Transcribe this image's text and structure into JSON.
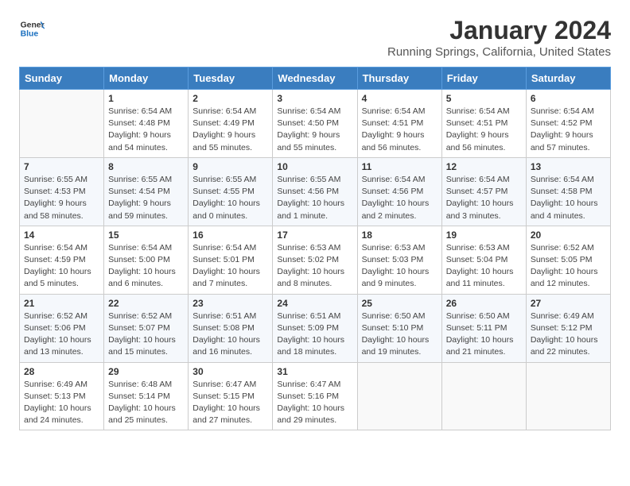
{
  "header": {
    "logo_general": "General",
    "logo_blue": "Blue",
    "month_year": "January 2024",
    "location": "Running Springs, California, United States"
  },
  "days_of_week": [
    "Sunday",
    "Monday",
    "Tuesday",
    "Wednesday",
    "Thursday",
    "Friday",
    "Saturday"
  ],
  "weeks": [
    [
      {
        "day": "",
        "info": ""
      },
      {
        "day": "1",
        "info": "Sunrise: 6:54 AM\nSunset: 4:48 PM\nDaylight: 9 hours\nand 54 minutes."
      },
      {
        "day": "2",
        "info": "Sunrise: 6:54 AM\nSunset: 4:49 PM\nDaylight: 9 hours\nand 55 minutes."
      },
      {
        "day": "3",
        "info": "Sunrise: 6:54 AM\nSunset: 4:50 PM\nDaylight: 9 hours\nand 55 minutes."
      },
      {
        "day": "4",
        "info": "Sunrise: 6:54 AM\nSunset: 4:51 PM\nDaylight: 9 hours\nand 56 minutes."
      },
      {
        "day": "5",
        "info": "Sunrise: 6:54 AM\nSunset: 4:51 PM\nDaylight: 9 hours\nand 56 minutes."
      },
      {
        "day": "6",
        "info": "Sunrise: 6:54 AM\nSunset: 4:52 PM\nDaylight: 9 hours\nand 57 minutes."
      }
    ],
    [
      {
        "day": "7",
        "info": "Sunrise: 6:55 AM\nSunset: 4:53 PM\nDaylight: 9 hours\nand 58 minutes."
      },
      {
        "day": "8",
        "info": "Sunrise: 6:55 AM\nSunset: 4:54 PM\nDaylight: 9 hours\nand 59 minutes."
      },
      {
        "day": "9",
        "info": "Sunrise: 6:55 AM\nSunset: 4:55 PM\nDaylight: 10 hours\nand 0 minutes."
      },
      {
        "day": "10",
        "info": "Sunrise: 6:55 AM\nSunset: 4:56 PM\nDaylight: 10 hours\nand 1 minute."
      },
      {
        "day": "11",
        "info": "Sunrise: 6:54 AM\nSunset: 4:56 PM\nDaylight: 10 hours\nand 2 minutes."
      },
      {
        "day": "12",
        "info": "Sunrise: 6:54 AM\nSunset: 4:57 PM\nDaylight: 10 hours\nand 3 minutes."
      },
      {
        "day": "13",
        "info": "Sunrise: 6:54 AM\nSunset: 4:58 PM\nDaylight: 10 hours\nand 4 minutes."
      }
    ],
    [
      {
        "day": "14",
        "info": "Sunrise: 6:54 AM\nSunset: 4:59 PM\nDaylight: 10 hours\nand 5 minutes."
      },
      {
        "day": "15",
        "info": "Sunrise: 6:54 AM\nSunset: 5:00 PM\nDaylight: 10 hours\nand 6 minutes."
      },
      {
        "day": "16",
        "info": "Sunrise: 6:54 AM\nSunset: 5:01 PM\nDaylight: 10 hours\nand 7 minutes."
      },
      {
        "day": "17",
        "info": "Sunrise: 6:53 AM\nSunset: 5:02 PM\nDaylight: 10 hours\nand 8 minutes."
      },
      {
        "day": "18",
        "info": "Sunrise: 6:53 AM\nSunset: 5:03 PM\nDaylight: 10 hours\nand 9 minutes."
      },
      {
        "day": "19",
        "info": "Sunrise: 6:53 AM\nSunset: 5:04 PM\nDaylight: 10 hours\nand 11 minutes."
      },
      {
        "day": "20",
        "info": "Sunrise: 6:52 AM\nSunset: 5:05 PM\nDaylight: 10 hours\nand 12 minutes."
      }
    ],
    [
      {
        "day": "21",
        "info": "Sunrise: 6:52 AM\nSunset: 5:06 PM\nDaylight: 10 hours\nand 13 minutes."
      },
      {
        "day": "22",
        "info": "Sunrise: 6:52 AM\nSunset: 5:07 PM\nDaylight: 10 hours\nand 15 minutes."
      },
      {
        "day": "23",
        "info": "Sunrise: 6:51 AM\nSunset: 5:08 PM\nDaylight: 10 hours\nand 16 minutes."
      },
      {
        "day": "24",
        "info": "Sunrise: 6:51 AM\nSunset: 5:09 PM\nDaylight: 10 hours\nand 18 minutes."
      },
      {
        "day": "25",
        "info": "Sunrise: 6:50 AM\nSunset: 5:10 PM\nDaylight: 10 hours\nand 19 minutes."
      },
      {
        "day": "26",
        "info": "Sunrise: 6:50 AM\nSunset: 5:11 PM\nDaylight: 10 hours\nand 21 minutes."
      },
      {
        "day": "27",
        "info": "Sunrise: 6:49 AM\nSunset: 5:12 PM\nDaylight: 10 hours\nand 22 minutes."
      }
    ],
    [
      {
        "day": "28",
        "info": "Sunrise: 6:49 AM\nSunset: 5:13 PM\nDaylight: 10 hours\nand 24 minutes."
      },
      {
        "day": "29",
        "info": "Sunrise: 6:48 AM\nSunset: 5:14 PM\nDaylight: 10 hours\nand 25 minutes."
      },
      {
        "day": "30",
        "info": "Sunrise: 6:47 AM\nSunset: 5:15 PM\nDaylight: 10 hours\nand 27 minutes."
      },
      {
        "day": "31",
        "info": "Sunrise: 6:47 AM\nSunset: 5:16 PM\nDaylight: 10 hours\nand 29 minutes."
      },
      {
        "day": "",
        "info": ""
      },
      {
        "day": "",
        "info": ""
      },
      {
        "day": "",
        "info": ""
      }
    ]
  ]
}
